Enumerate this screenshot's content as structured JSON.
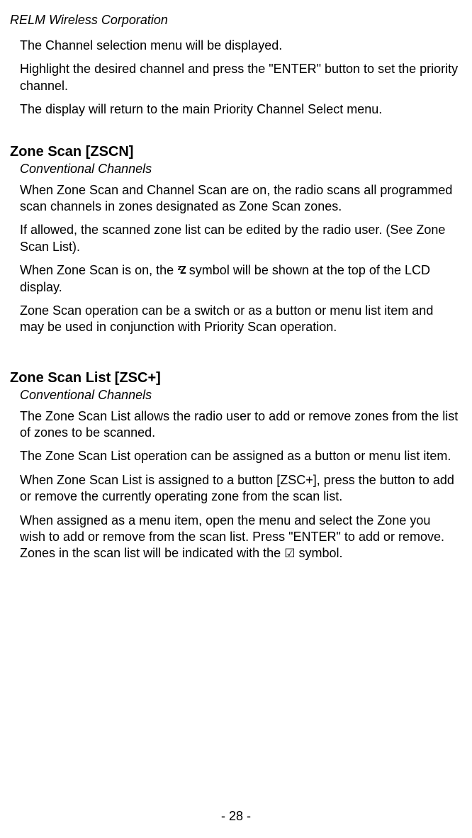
{
  "header": "RELM Wireless Corporation",
  "intro": {
    "p1": "The Channel selection menu will be displayed.",
    "p2": "Highlight the desired channel and press the \"ENTER\" button to set the priority channel.",
    "p3": "The display will return to the main Priority Channel Select menu."
  },
  "section1": {
    "heading": "Zone Scan [ZSCN]",
    "sub": "Conventional Channels",
    "p1": "When Zone Scan and Channel Scan are on, the radio scans all programmed scan channels in zones designated as Zone Scan zones.",
    "p2": "If allowed, the scanned zone list can be edited by the radio user. (See Zone Scan List).",
    "p3a": "When Zone Scan is on, the ",
    "p3b": " symbol will be shown at the top of the LCD display.",
    "p4": "Zone Scan operation can be a switch or as a button or menu list item and may be used in conjunction with Priority Scan operation."
  },
  "section2": {
    "heading": "Zone Scan List [ZSC+]",
    "sub": "Conventional Channels",
    "p1": "The Zone Scan List allows the radio user to add or remove zones from the list of zones to be scanned.",
    "p2": "The Zone Scan List operation can be assigned as a button or menu list item.",
    "p3": "When Zone Scan List is assigned to a button [ZSC+], press the button to add or remove the currently operating zone from the scan list.",
    "p4a": "When assigned as a menu item, open the menu and select the Zone you wish to add or remove from the scan list. Press \"ENTER\" to add or remove. Zones in the scan list will be indicated with the ",
    "p4b": " symbol."
  },
  "pageNumber": "- 28 -",
  "icons": {
    "zz": "zZ",
    "checkbox": "☑"
  }
}
